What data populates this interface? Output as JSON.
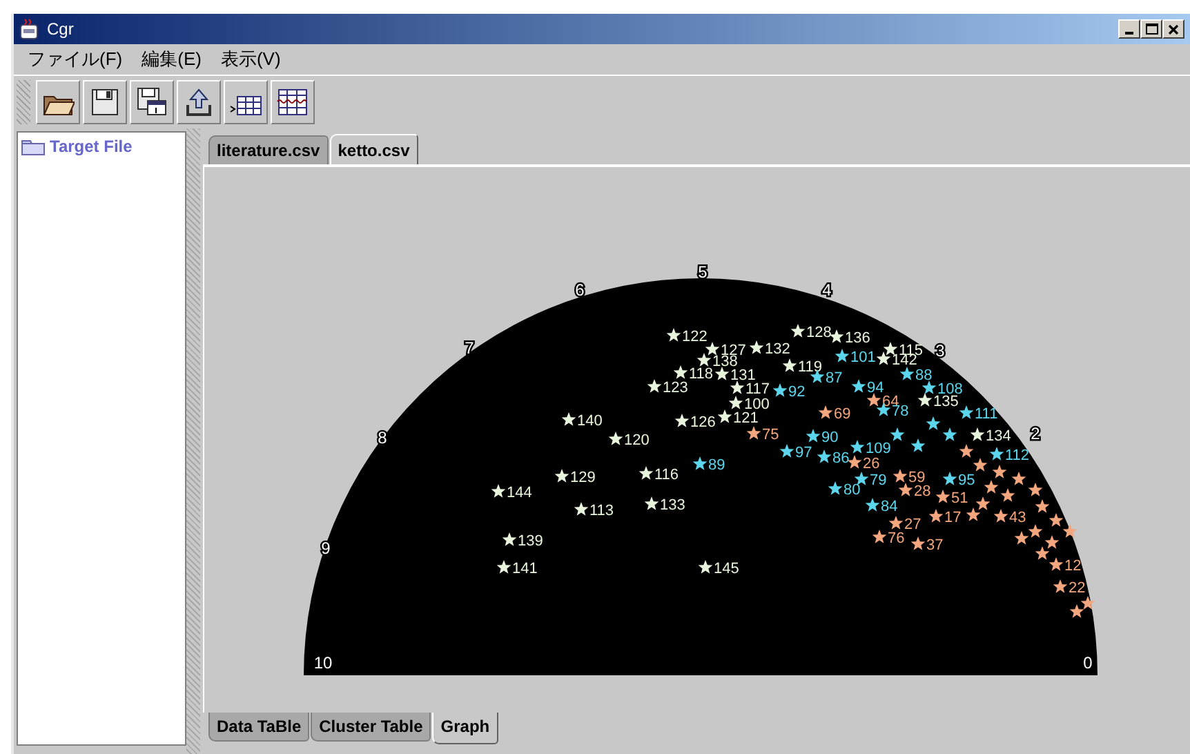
{
  "window": {
    "title": "Cgr"
  },
  "window_controls": [
    {
      "kind": "minimize"
    },
    {
      "kind": "maximize"
    },
    {
      "kind": "close"
    }
  ],
  "menu": [
    "ファイル(F)",
    "編集(E)",
    "表示(V)"
  ],
  "toolbar": [
    {
      "kind": "open"
    },
    {
      "kind": "save"
    },
    {
      "kind": "save-as"
    },
    {
      "kind": "export"
    },
    {
      "kind": "table-in"
    },
    {
      "kind": "table-split"
    }
  ],
  "sidebar": {
    "items": [
      {
        "label": "Target File"
      }
    ]
  },
  "file_tabs": [
    {
      "label": "literature.csv",
      "selected": false
    },
    {
      "label": "ketto.csv",
      "selected": true
    }
  ],
  "graph": {
    "ticks": [
      "10",
      "9",
      "8",
      "7",
      "6",
      "5",
      "4",
      "3",
      "2",
      "0"
    ],
    "points": [
      {
        "label": "122",
        "color": "#e8f4dc"
      },
      {
        "label": "128",
        "color": "#e8f4dc"
      },
      {
        "label": "136",
        "color": "#e8f4dc"
      },
      {
        "label": "127",
        "color": "#e8f4dc"
      },
      {
        "label": "132",
        "color": "#e8f4dc"
      },
      {
        "label": "115",
        "color": "#e8f4dc"
      },
      {
        "label": "138",
        "color": "#e8f4dc"
      },
      {
        "label": "101",
        "color": "#5cd6ec"
      },
      {
        "label": "142",
        "color": "#e8f4dc"
      },
      {
        "label": "119",
        "color": "#e8f4dc"
      },
      {
        "label": "118",
        "color": "#e8f4dc"
      },
      {
        "label": "131",
        "color": "#e8f4dc"
      },
      {
        "label": "87",
        "color": "#5cd6ec"
      },
      {
        "label": "88",
        "color": "#5cd6ec"
      },
      {
        "label": "123",
        "color": "#e8f4dc"
      },
      {
        "label": "117",
        "color": "#e8f4dc"
      },
      {
        "label": "92",
        "color": "#5cd6ec"
      },
      {
        "label": "94",
        "color": "#5cd6ec"
      },
      {
        "label": "108",
        "color": "#5cd6ec"
      },
      {
        "label": "100",
        "color": "#e8f4dc"
      },
      {
        "label": "64",
        "color": "#f4a67e"
      },
      {
        "label": "135",
        "color": "#e8f4dc"
      },
      {
        "label": "69",
        "color": "#f4a67e"
      },
      {
        "label": "78",
        "color": "#5cd6ec"
      },
      {
        "label": "111",
        "color": "#5cd6ec"
      },
      {
        "label": "140",
        "color": "#e8f4dc"
      },
      {
        "label": "126",
        "color": "#e8f4dc"
      },
      {
        "label": "121",
        "color": "#e8f4dc"
      },
      {
        "label": "120",
        "color": "#e8f4dc"
      },
      {
        "label": "75",
        "color": "#f4a67e"
      },
      {
        "label": "90",
        "color": "#5cd6ec"
      },
      {
        "label": "134",
        "color": "#e8f4dc"
      },
      {
        "label": "97",
        "color": "#5cd6ec"
      },
      {
        "label": "86",
        "color": "#5cd6ec"
      },
      {
        "label": "109",
        "color": "#5cd6ec"
      },
      {
        "label": "112",
        "color": "#5cd6ec"
      },
      {
        "label": "89",
        "color": "#5cd6ec"
      },
      {
        "label": "26",
        "color": "#f4a67e"
      },
      {
        "label": "129",
        "color": "#e8f4dc"
      },
      {
        "label": "116",
        "color": "#e8f4dc"
      },
      {
        "label": "79",
        "color": "#5cd6ec"
      },
      {
        "label": "59",
        "color": "#f4a67e"
      },
      {
        "label": "95",
        "color": "#5cd6ec"
      },
      {
        "label": "144",
        "color": "#e8f4dc"
      },
      {
        "label": "80",
        "color": "#5cd6ec"
      },
      {
        "label": "28",
        "color": "#f4a67e"
      },
      {
        "label": "51",
        "color": "#f4a67e"
      },
      {
        "label": "113",
        "color": "#e8f4dc"
      },
      {
        "label": "133",
        "color": "#e8f4dc"
      },
      {
        "label": "84",
        "color": "#5cd6ec"
      },
      {
        "label": "27",
        "color": "#f4a67e"
      },
      {
        "label": "17",
        "color": "#f4a67e"
      },
      {
        "label": "43",
        "color": "#f4a67e"
      },
      {
        "label": "139",
        "color": "#e8f4dc"
      },
      {
        "label": "76",
        "color": "#f4a67e"
      },
      {
        "label": "37",
        "color": "#f4a67e"
      },
      {
        "label": "141",
        "color": "#e8f4dc"
      },
      {
        "label": "145",
        "color": "#e8f4dc"
      },
      {
        "label": "12",
        "color": "#f4a67e"
      },
      {
        "label": "22",
        "color": "#f4a67e"
      },
      {
        "color": "#5cd6ec"
      },
      {
        "color": "#5cd6ec"
      },
      {
        "color": "#5cd6ec"
      },
      {
        "color": "#5cd6ec"
      },
      {
        "color": "#f4a67e"
      },
      {
        "color": "#f4a67e"
      },
      {
        "color": "#f4a67e"
      },
      {
        "color": "#f4a67e"
      },
      {
        "color": "#f4a67e"
      },
      {
        "color": "#f4a67e"
      },
      {
        "color": "#f4a67e"
      },
      {
        "color": "#f4a67e"
      },
      {
        "color": "#f4a67e"
      },
      {
        "color": "#f4a67e"
      },
      {
        "color": "#f4a67e"
      },
      {
        "color": "#f4a67e"
      },
      {
        "color": "#f4a67e"
      },
      {
        "color": "#f4a67e"
      },
      {
        "color": "#f4a67e"
      },
      {
        "color": "#f4a67e"
      },
      {
        "color": "#f4a67e"
      },
      {
        "color": "#f4a67e"
      }
    ]
  },
  "view_tabs": [
    {
      "label": "Data TaBle",
      "selected": false
    },
    {
      "label": "Cluster Table",
      "selected": false
    },
    {
      "label": "Graph",
      "selected": true
    }
  ]
}
